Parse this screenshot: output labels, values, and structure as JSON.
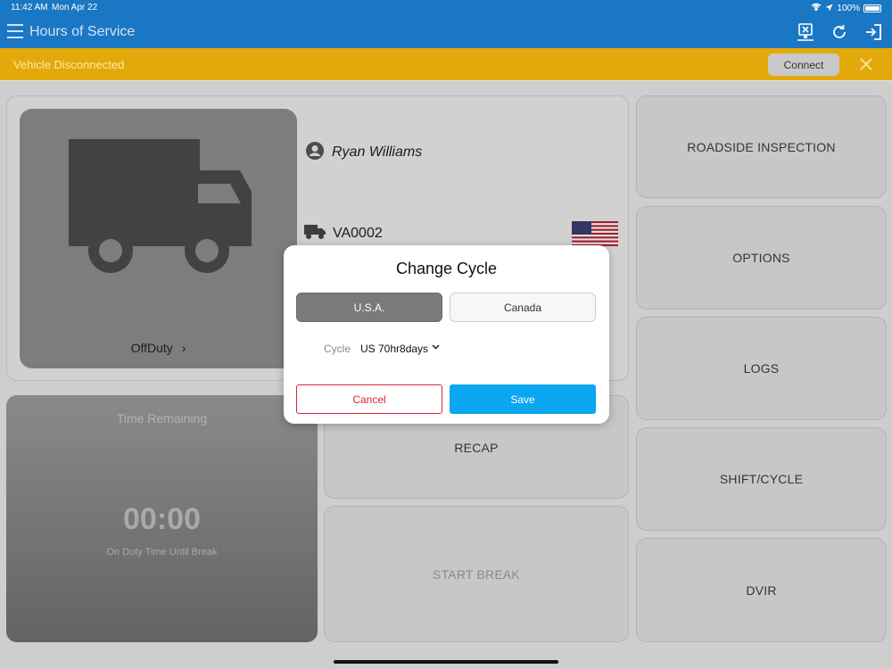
{
  "status_bar": {
    "time": "11:42 AM",
    "date": "Mon Apr 22",
    "battery": "100%"
  },
  "nav": {
    "title": "Hours of Service"
  },
  "banner": {
    "message": "Vehicle Disconnected",
    "connect_label": "Connect"
  },
  "driver": {
    "name": "Ryan Williams",
    "vehicle": "VA0002",
    "duty_status": "OffDuty"
  },
  "time_remaining": {
    "title": "Time Remaining",
    "value": "00:00",
    "subtitle": "On Duty Time Until Break"
  },
  "actions": {
    "recap": "RECAP",
    "start_break": "START BREAK",
    "roadside_inspection": "ROADSIDE INSPECTION",
    "options": "OPTIONS",
    "logs": "LOGS",
    "shift_cycle": "SHIFT/CYCLE",
    "dvir": "DVIR"
  },
  "modal": {
    "title": "Change Cycle",
    "country_options": [
      "U.S.A.",
      "Canada"
    ],
    "selected_country": "U.S.A.",
    "cycle_label": "Cycle",
    "cycle_value": "US 70hr8days",
    "cancel_label": "Cancel",
    "save_label": "Save"
  },
  "colors": {
    "nav": "#1a77c4",
    "banner": "#e3a90a",
    "save": "#0aa6f0",
    "cancel": "#d9233d"
  }
}
